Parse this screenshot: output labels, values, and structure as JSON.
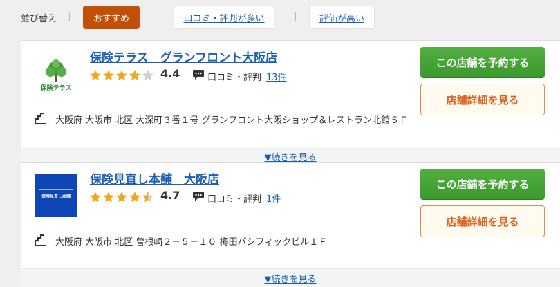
{
  "sort": {
    "label": "並び替え",
    "options": [
      "おすすめ",
      "口コミ・評判が多い",
      "評価が高い"
    ]
  },
  "colors": {
    "accent": "#c14f06",
    "link": "#1a5fb4",
    "reserve_green": "#44a234",
    "detail_orange": "#d8621e",
    "star_gold": "#f0a81a"
  },
  "shops": [
    {
      "name": "保険テラス　グランフロント大阪店",
      "logo_text": "保険テラス",
      "rating": "4.4",
      "rating_stars": 4.4,
      "review_label": "口コミ・評判",
      "review_count": "13件",
      "address": "大阪府 大阪市 北区 大深町３番１号 グランフロント大阪ショップ＆レストラン北館５Ｆ",
      "reserve_label": "この店舗を予約する",
      "detail_label": "店舗詳細を見る",
      "more_label": "▼続きを見る"
    },
    {
      "name": "保険見直し本舗　大阪店",
      "logo_text": "保険見直し本舗",
      "rating": "4.7",
      "rating_stars": 4.7,
      "review_label": "口コミ・評判",
      "review_count": "1件",
      "address": "大阪府 大阪市 北区 曽根崎２－５－１０ 梅田パシフィックビル１Ｆ",
      "reserve_label": "この店舗を予約する",
      "detail_label": "店舗詳細を見る",
      "more_label": "▼続きを見る"
    }
  ]
}
